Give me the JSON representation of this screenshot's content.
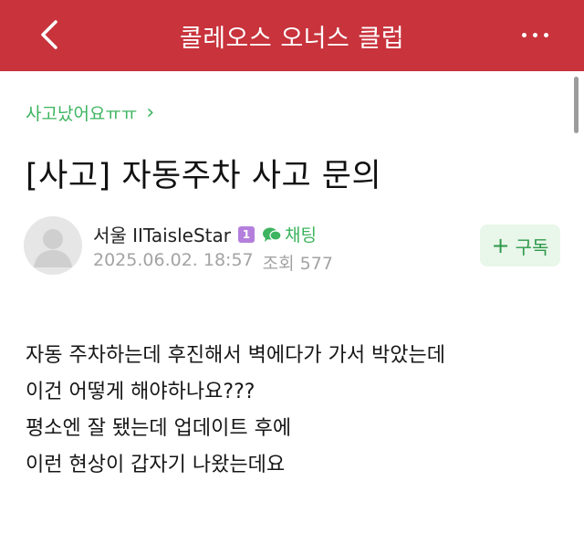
{
  "header": {
    "title": "콜레오스 오너스 클럽",
    "background": "#c8333c",
    "back_icon": "chevron-left-icon",
    "more_icon": "more-horizontal-icon"
  },
  "board": {
    "name": "사고났어요ㅠㅠ",
    "chevron": "›",
    "color": "#3db45f"
  },
  "post": {
    "title": "[사고] 자동주차 사고 문의",
    "author": "서울 IITaisleStar",
    "level": "1",
    "chat_label": "채팅",
    "date": "2025.06.02. 18:57",
    "views_label": "조회",
    "views": "577",
    "subscribe_label": "구독",
    "subscribe_icon": "+",
    "body": [
      "자동 주차하는데 후진해서 벽에다가 가서 박았는데",
      "이건 어떻게 해야하나요???",
      "평소엔 잘 됐는데 업데이트 후에",
      "이런 현상이 갑자기 나왔는데요"
    ]
  }
}
